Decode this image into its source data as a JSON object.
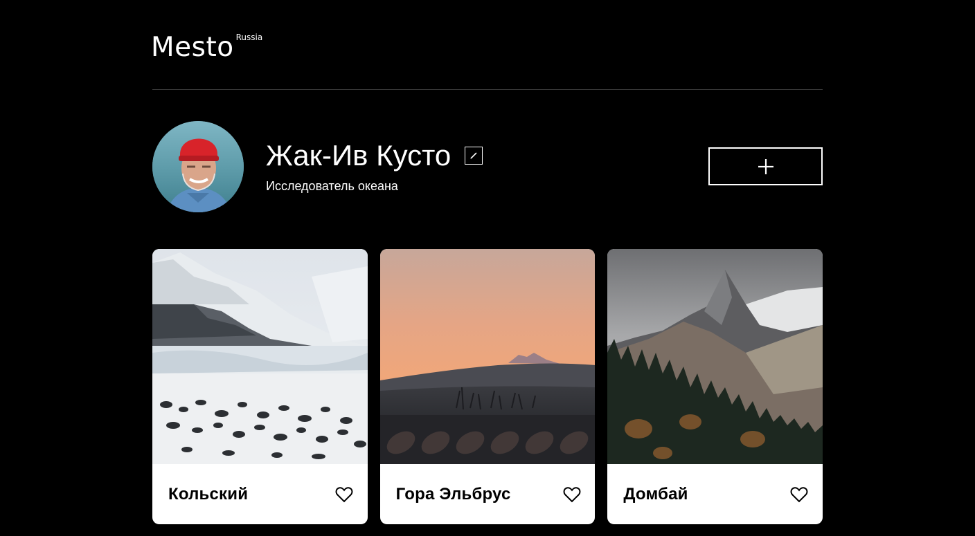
{
  "header": {
    "logo_text": "Mesto",
    "logo_superscript": "Russia"
  },
  "profile": {
    "name": "Жак-Ив Кусто",
    "about": "Исследователь океана",
    "edit_icon": "pencil-icon",
    "add_icon": "plus-icon"
  },
  "cards": [
    {
      "title": "Кольский",
      "image": "snowy-coast-photo",
      "like_icon": "heart-outline-icon"
    },
    {
      "title": "Гора Эльбрус",
      "image": "sunset-mountain-photo",
      "like_icon": "heart-outline-icon"
    },
    {
      "title": "Домбай",
      "image": "forest-peak-photo",
      "like_icon": "heart-outline-icon"
    }
  ],
  "colors": {
    "background": "#000000",
    "text": "#ffffff",
    "card_background": "#ffffff",
    "card_text": "#000000",
    "divider": "#545454"
  }
}
